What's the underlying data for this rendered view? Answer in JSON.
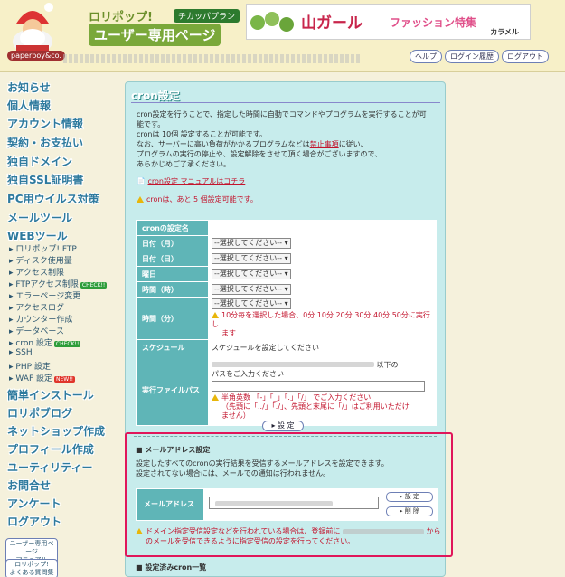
{
  "header": {
    "logo_label": "paperboy&co.",
    "brand_top": "ロリポップ!",
    "plan_badge": "チカッパプラン",
    "brand_sub": "ユーザー専用ページ",
    "banner_title": "山ガール",
    "banner_sub": "ファッション特集",
    "banner_credit": "カラメル",
    "links": [
      "ヘルプ",
      "ログイン履歴",
      "ログアウト"
    ]
  },
  "sidebar": {
    "items": [
      "お知らせ",
      "個人情報",
      "アカウント情報",
      "契約・お支払い",
      "独自ドメイン",
      "独自SSL証明書",
      "PC用ウイルス対策",
      "メールツール",
      "WEBツール"
    ],
    "sub_items": [
      "ロリポップ! FTP",
      "ディスク使用量",
      "アクセス制限",
      "FTPアクセス制限",
      "エラーページ変更",
      "アクセスログ",
      "カウンター作成",
      "データベース",
      "cron 設定",
      "SSH",
      "PHP 設定",
      "WAF 設定"
    ],
    "badge_check": "CHECK!!",
    "badge_new": "NEW!!",
    "items2": [
      "簡単インストール",
      "ロリポブログ",
      "ネットショップ作成",
      "プロフィール作成",
      "ユーティリティー",
      "お問合せ",
      "アンケート",
      "ログアウト"
    ],
    "manual_btn": [
      "ユーザー専用ページ",
      "マニュアル"
    ],
    "faq_btn": [
      "ロリポップ!",
      "よくある質問集"
    ]
  },
  "main": {
    "title": "cron設定",
    "intro": [
      "cron設定を行うことで、指定した時間に自動でコマンドやプログラムを実行することが可",
      "能です。",
      "cronは 10個 設定することが可能です。",
      "なお、サーバーに高い負荷がかかるプログラムなどは",
      "禁止事項",
      "に従い、",
      "プログラムの実行の停止や、設定解除をさせて頂く場合がございますので、",
      "あらかじめご了承ください。"
    ],
    "manual_link": "cron設定 マニュアルはコチラ",
    "remaining": "cronは、あと 5 個設定可能です。",
    "form": {
      "name_label": "cronの設定名",
      "month_label": "日付（月）",
      "day_label": "日付（日）",
      "weekday_label": "曜日",
      "hour_label": "時間（時）",
      "minute_label": "時間（分）",
      "select_placeholder": "--選択してください--",
      "minute_warn": "10分毎を選択した場合、0分 10分 20分 30分 40分 50分に実行し",
      "minute_warn2": "ます",
      "schedule_label": "スケジュール",
      "schedule_value": "スケジュールを設定してください",
      "path_label": "実行ファイルパス",
      "path_suffix": "以下の",
      "path_hint": "パスをご入力ください",
      "path_warn1": "半角英数 「-」「_」「.」「/」 でご入力ください",
      "path_warn2": "（先頭に「../」「./」、先頭と末尾に「/」はご利用いただけ",
      "path_warn3": "ません）",
      "submit": "設 定"
    },
    "mail": {
      "header": "■ メールアドレス設定",
      "desc1": "設定したすべてのcronの実行結果を受信するメールアドレスを設定できます。",
      "desc2": "設定されてない場合には、メールでの通知は行われません。",
      "label": "メールアドレス",
      "set_btn": "設 定",
      "del_btn": "削 除",
      "warn1": "ドメイン指定受信設定などを行われている場合は、登録前に",
      "warn1b": "から",
      "warn2": "のメールを受信できるように指定受信の設定を行ってください。"
    },
    "list_header": "■ 設定済みcron一覧"
  },
  "colors": {
    "panel": "#c7ecec",
    "label_cell": "#5fb5b7",
    "highlight_border": "#e0165a",
    "warn_text": "#c3142d"
  }
}
